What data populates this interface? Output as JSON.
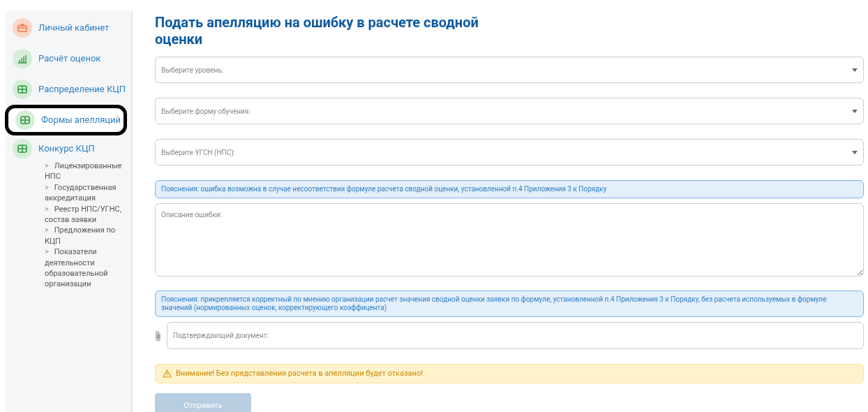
{
  "sidebar": {
    "items": [
      {
        "label": "Личный кабинет",
        "kind": "briefcase",
        "selected": false
      },
      {
        "label": "Расчёт оценок",
        "kind": "chart",
        "selected": false
      },
      {
        "label": "Распределение КЦП",
        "kind": "table",
        "selected": false
      },
      {
        "label": "Формы апелляций",
        "kind": "table",
        "selected": true
      },
      {
        "label": "Конкурс КЦП",
        "kind": "table",
        "selected": false,
        "children": [
          {
            "marker": ">",
            "label": "Лицензированные НПС"
          },
          {
            "marker": ">",
            "label": "Государственная аккредитация"
          },
          {
            "marker": ">",
            "label": "Реестр НПС/УГНС, состав заявки"
          },
          {
            "marker": ">",
            "label": "Предложения по КЦП"
          },
          {
            "marker": ">",
            "label": "Показатели деятельности образовательной организации"
          }
        ]
      }
    ]
  },
  "title": "Подать апелляцию на ошибку в расчете сводной оценки",
  "form": [
    {
      "kind": "select",
      "placeholder": "Выберите уровень:"
    },
    {
      "kind": "select",
      "placeholder": "Выберите форму обучения:"
    },
    {
      "kind": "select",
      "placeholder": "Выберите УГСН (НПС):"
    },
    {
      "kind": "info",
      "text": "Пояснения: ошибка возможна в случае несоответствия формуле расчета сводной оценки, установленной п.4 Приложения 3 к Порядку"
    },
    {
      "kind": "textarea",
      "placeholder": "Описание ошибки:"
    },
    {
      "kind": "info",
      "text": "Пояснения: прикрепляется корректный по мнению организации расчет значения сводной оценки заявки по формуле, установленной п.4 Приложения 3 к Порядку, без расчета используемых в формуле значений (нормированных оценок, корректирующего коэффицента)"
    },
    {
      "kind": "file",
      "placeholder": "Подтверждающий документ:"
    },
    {
      "kind": "warning",
      "text": "Внимание! Без представления расчета в апелляции будет отказано!"
    }
  ],
  "submit": {
    "label": "Отправить",
    "disabled": true
  }
}
